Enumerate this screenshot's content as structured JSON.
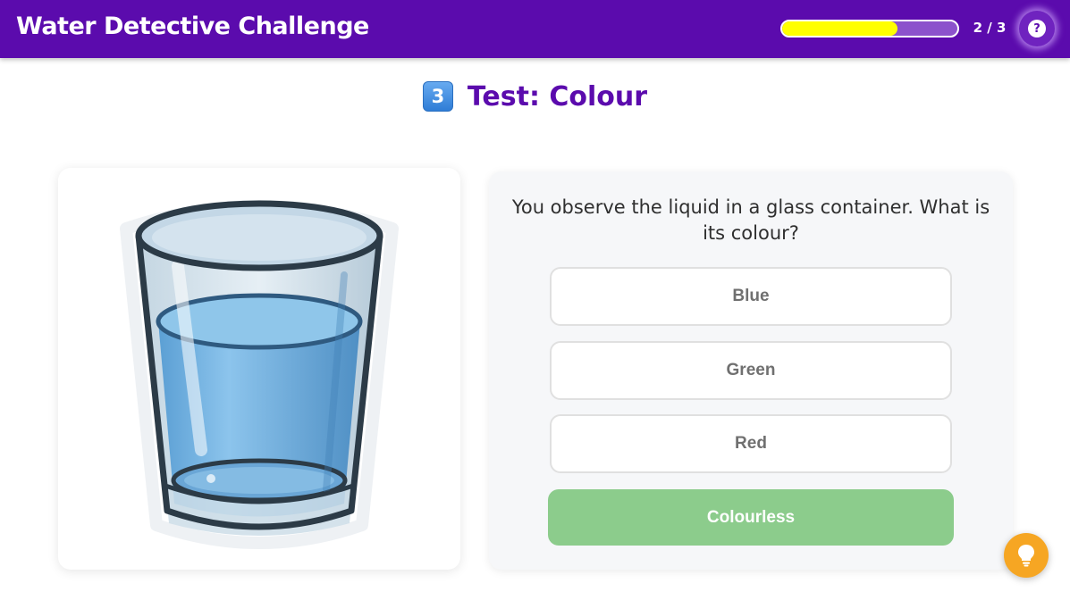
{
  "header": {
    "title": "Water Detective Challenge",
    "progress": {
      "current": 2,
      "total": 3,
      "label": "2 / 3",
      "fraction": 0.66
    },
    "help_icon": "question-mark-icon",
    "help_glyph": "?"
  },
  "step": {
    "number": "3",
    "title": "Test: Colour"
  },
  "image": {
    "subject": "glass-of-water-icon"
  },
  "question": {
    "text": "You observe the liquid in a glass container. What is its colour?",
    "options": [
      {
        "label": "Blue",
        "state": "default"
      },
      {
        "label": "Green",
        "state": "default"
      },
      {
        "label": "Red",
        "state": "default"
      },
      {
        "label": "Colourless",
        "state": "correct"
      }
    ]
  },
  "hint": {
    "icon": "lightbulb-icon"
  },
  "colors": {
    "header_bg": "#5b0bad",
    "progress_fill": "#ffff00",
    "title": "#5b0bad",
    "correct": "#8ccc8c",
    "hint": "#f6a623"
  }
}
